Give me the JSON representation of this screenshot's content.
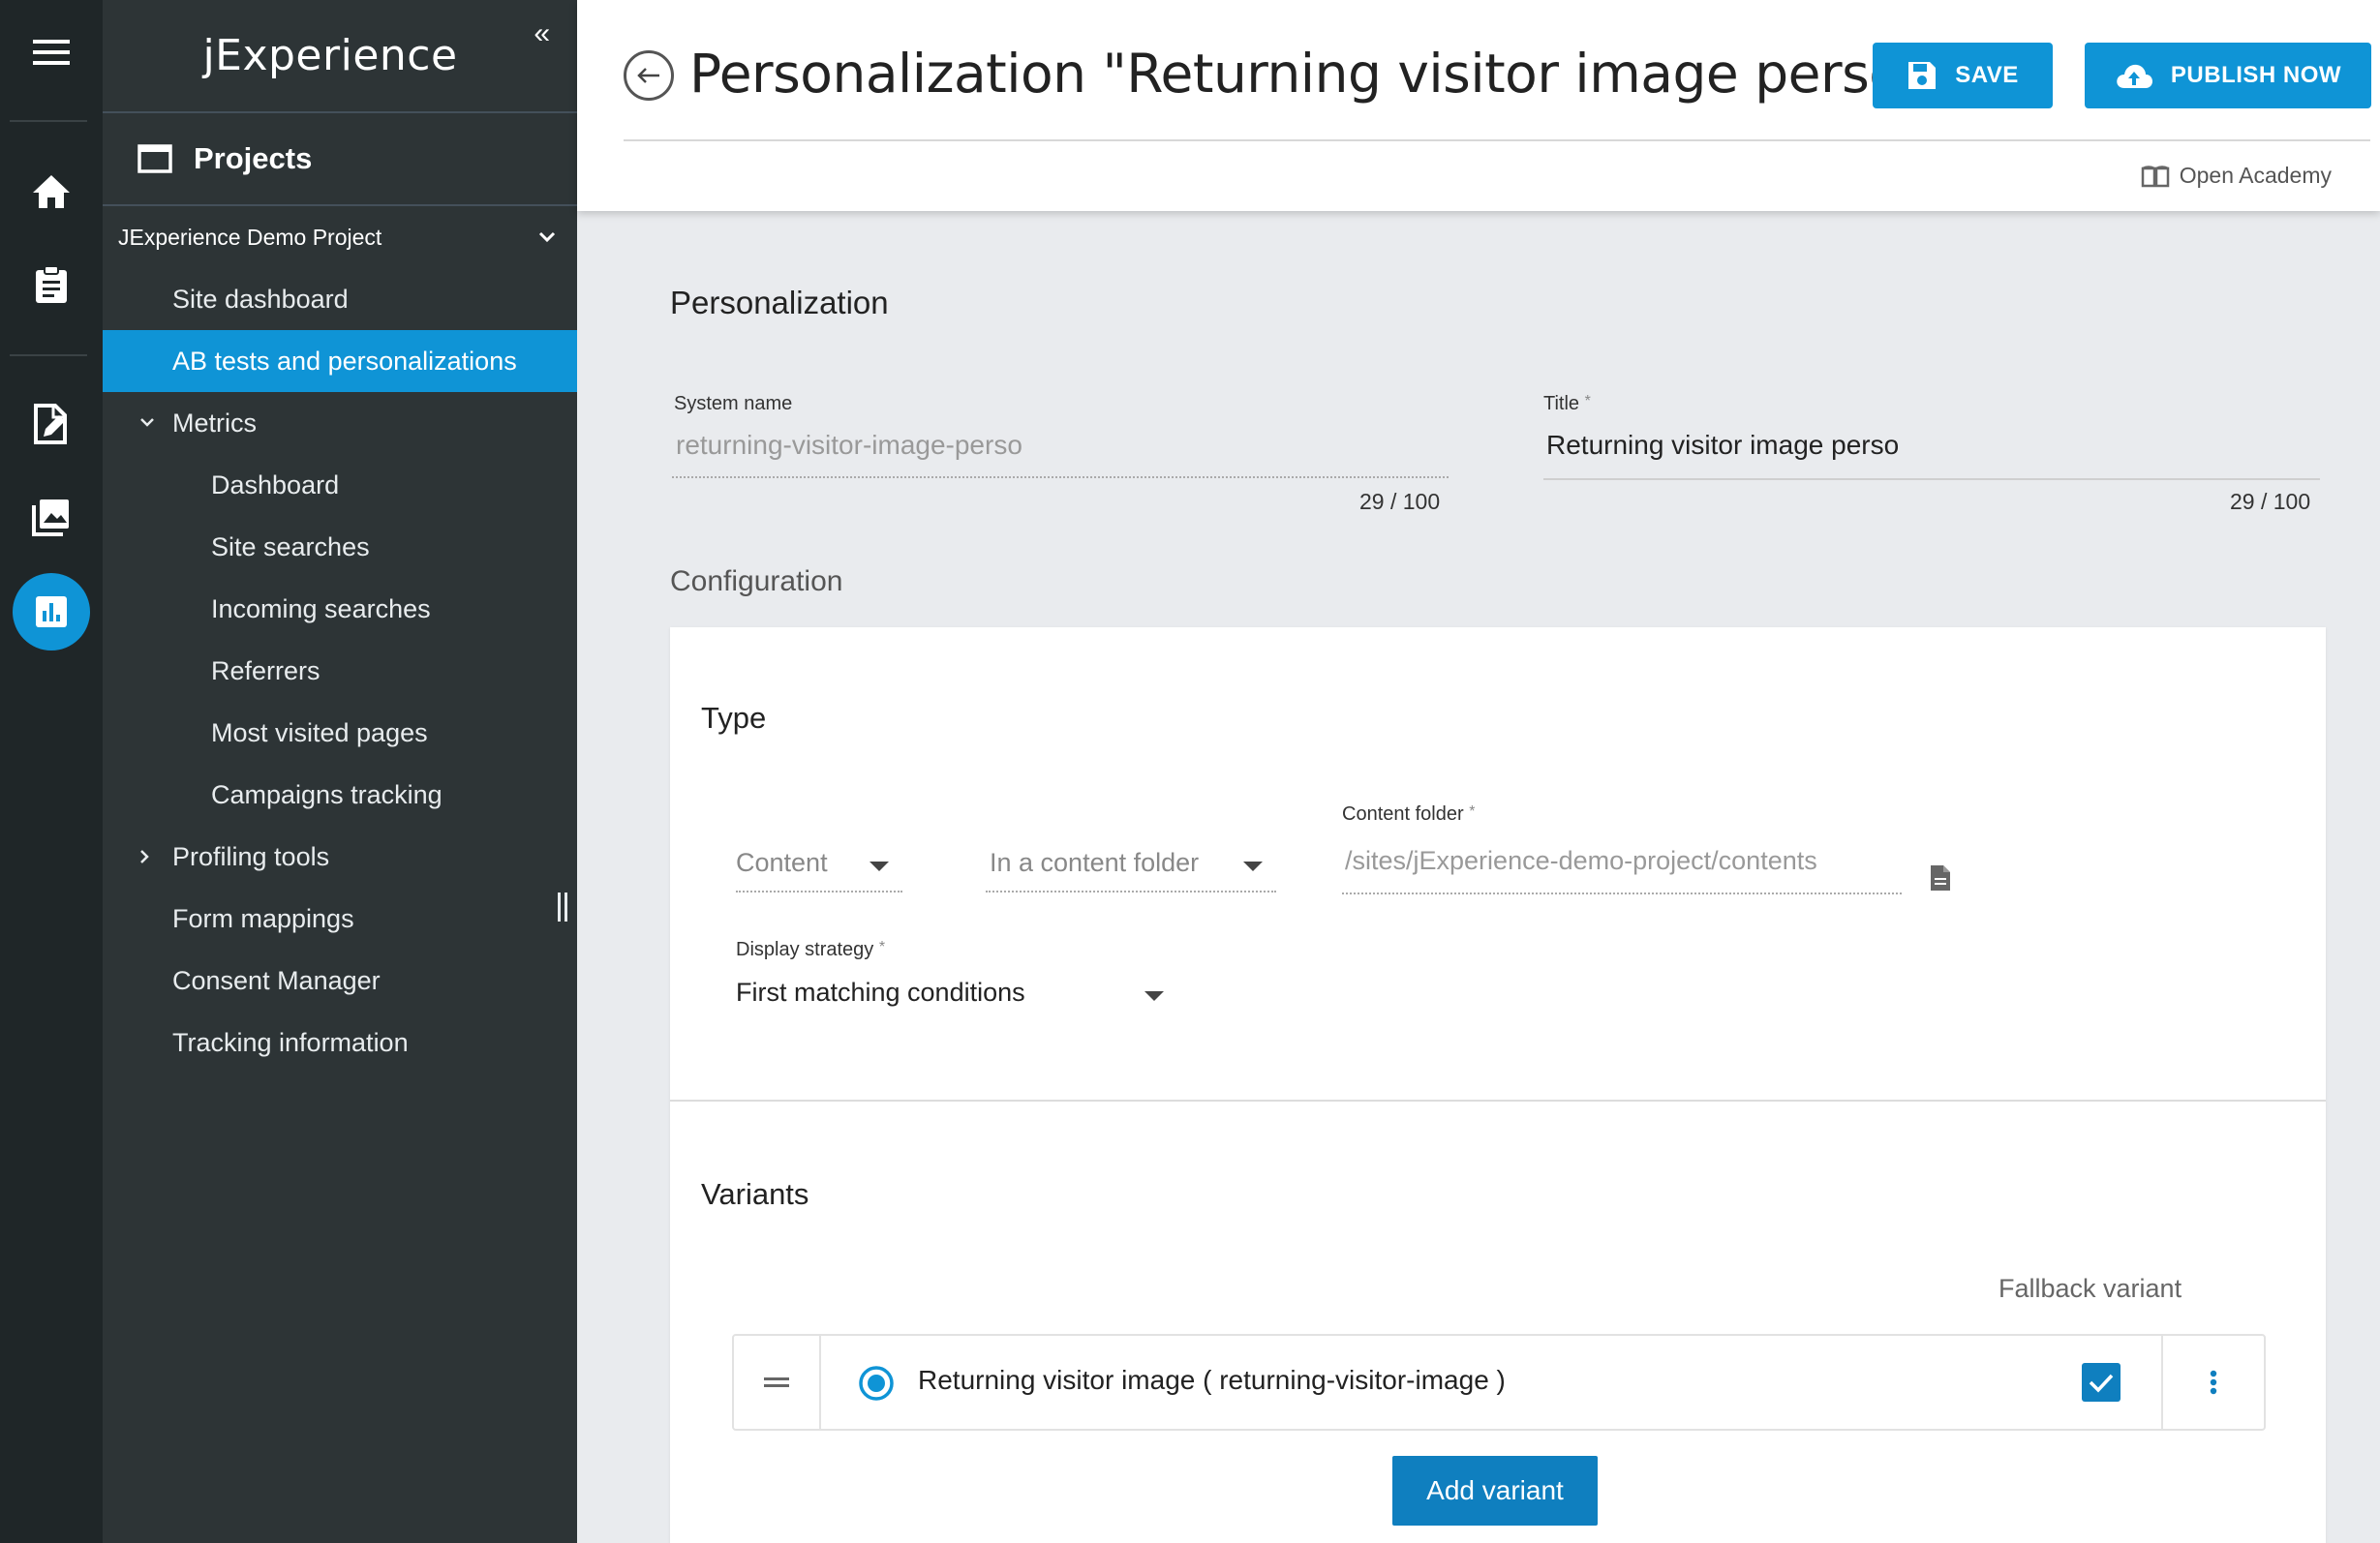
{
  "app": {
    "brand": "jExperience"
  },
  "rail": {
    "icons": [
      "menu-icon",
      "home-icon",
      "clipboard-icon",
      "document-edit-icon",
      "gallery-icon",
      "chart-icon"
    ],
    "accent": "#0f94d6"
  },
  "sidebar": {
    "collapse_label": "«",
    "projects_title": "Projects",
    "project_name": "JExperience Demo Project",
    "items": [
      {
        "label": "Site dashboard"
      },
      {
        "label": "AB tests and personalizations"
      },
      {
        "label": "Metrics"
      },
      {
        "label": "Dashboard"
      },
      {
        "label": "Site searches"
      },
      {
        "label": "Incoming searches"
      },
      {
        "label": "Referrers"
      },
      {
        "label": "Most visited pages"
      },
      {
        "label": "Campaigns tracking"
      },
      {
        "label": "Profiling tools"
      },
      {
        "label": "Form mappings"
      },
      {
        "label": "Consent Manager"
      },
      {
        "label": "Tracking information"
      }
    ]
  },
  "header": {
    "title": "Personalization \"Returning visitor image perso\"",
    "save_label": "SAVE",
    "publish_label": "PUBLISH NOW",
    "academy_label": "Open Academy"
  },
  "form": {
    "section_title": "Personalization",
    "system_name_label": "System name",
    "system_name_value": "returning-visitor-image-perso",
    "system_name_counter": "29 / 100",
    "title_label": "Title",
    "title_value": "Returning visitor image perso",
    "title_counter": "29 / 100",
    "required_mark": "*",
    "configuration_title": "Configuration"
  },
  "type_section": {
    "title": "Type",
    "content_select": "Content",
    "location_select": "In a content folder",
    "content_folder_label": "Content folder",
    "content_folder_value": "/sites/jExperience-demo-project/contents",
    "display_strategy_label": "Display strategy",
    "display_strategy_value": "First matching conditions"
  },
  "variants": {
    "title": "Variants",
    "fallback_header": "Fallback variant",
    "rows": [
      {
        "label": "Returning visitor image ( returning-visitor-image )",
        "selected": true,
        "fallback": true
      }
    ],
    "add_label": "Add variant"
  }
}
